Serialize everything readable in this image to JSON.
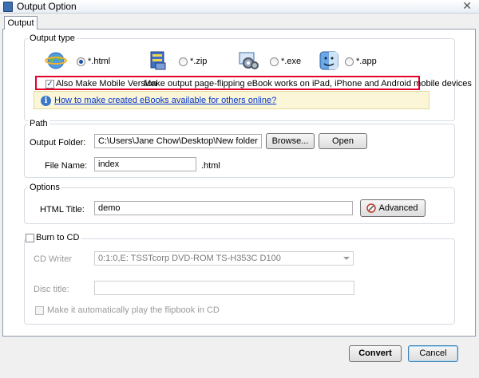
{
  "window": {
    "title": "Output Option",
    "close_glyph": "✕"
  },
  "tab": {
    "label": "Output"
  },
  "output_type": {
    "legend": "Output type",
    "options": [
      {
        "label": "*.html",
        "checked": true,
        "icon": "globe-icon"
      },
      {
        "label": "*.zip",
        "checked": false,
        "icon": "zip-archive-icon"
      },
      {
        "label": "*.exe",
        "checked": false,
        "icon": "gears-icon"
      },
      {
        "label": "*.app",
        "checked": false,
        "icon": "mac-finder-icon"
      }
    ],
    "mobile_checkbox_label": "Also Make Mobile Version",
    "mobile_checkbox_checked": true,
    "mobile_description": "Make output page-flipping eBook works on iPad, iPhone and Android mobile devices",
    "info_link": "How to make created eBooks available for others online?",
    "info_glyph": "i",
    "highlight_color": "#e3002b"
  },
  "path": {
    "legend": "Path",
    "output_folder_label": "Output Folder:",
    "output_folder_value": "C:\\Users\\Jane Chow\\Desktop\\New folder",
    "browse_button": "Browse...",
    "open_button": "Open",
    "file_name_label": "File Name:",
    "file_name_value": "index",
    "file_ext": ".html"
  },
  "options": {
    "legend": "Options",
    "html_title_label": "HTML Title:",
    "html_title_value": "demo",
    "advanced_button": "Advanced"
  },
  "burn": {
    "checkbox_label": "Burn to CD",
    "checked": false,
    "cd_writer_label": "CD Writer",
    "cd_writer_value": "0:1:0,E: TSSTcorp DVD-ROM TS-H353C D100",
    "disc_title_label": "Disc title:",
    "disc_title_value": "",
    "autoplay_label": "Make it automatically play the flipbook in CD",
    "autoplay_checked": false
  },
  "footer": {
    "convert_button": "Convert",
    "cancel_button": "Cancel"
  }
}
